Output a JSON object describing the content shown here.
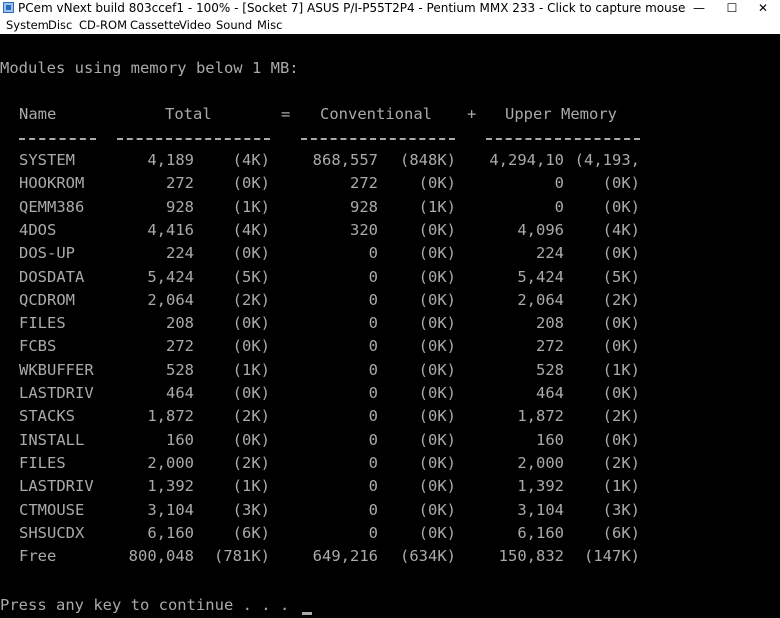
{
  "window": {
    "title": "PCem vNext build 803ccef1 - 100% - [Socket 7] ASUS P/I-P55T2P4 - Pentium MMX 233 - Click to capture mouse",
    "minimize_glyph": "—",
    "maximize_glyph": "☐",
    "close_glyph": "✕"
  },
  "menu": [
    "System",
    "Disc",
    "CD-ROM",
    "Cassette",
    "Video",
    "Sound",
    "Misc"
  ],
  "console": {
    "heading": "Modules using memory below 1 MB:",
    "columns": {
      "name": "Name",
      "total": "Total",
      "equals": "=",
      "conventional": "Conventional",
      "plus": "+",
      "upper": "Upper Memory"
    },
    "rows": [
      [
        "SYSTEM",
        "4,189",
        "(4K)",
        "868,557",
        "(848K)",
        "4,294,10",
        "(4,193,"
      ],
      [
        "HOOKROM",
        "272",
        "(0K)",
        "272",
        "(0K)",
        "0",
        "(0K)"
      ],
      [
        "QEMM386",
        "928",
        "(1K)",
        "928",
        "(1K)",
        "0",
        "(0K)"
      ],
      [
        "4DOS",
        "4,416",
        "(4K)",
        "320",
        "(0K)",
        "4,096",
        "(4K)"
      ],
      [
        "DOS-UP",
        "224",
        "(0K)",
        "0",
        "(0K)",
        "224",
        "(0K)"
      ],
      [
        "DOSDATA",
        "5,424",
        "(5K)",
        "0",
        "(0K)",
        "5,424",
        "(5K)"
      ],
      [
        "QCDROM",
        "2,064",
        "(2K)",
        "0",
        "(0K)",
        "2,064",
        "(2K)"
      ],
      [
        "FILES",
        "208",
        "(0K)",
        "0",
        "(0K)",
        "208",
        "(0K)"
      ],
      [
        "FCBS",
        "272",
        "(0K)",
        "0",
        "(0K)",
        "272",
        "(0K)"
      ],
      [
        "WKBUFFER",
        "528",
        "(1K)",
        "0",
        "(0K)",
        "528",
        "(1K)"
      ],
      [
        "LASTDRIV",
        "464",
        "(0K)",
        "0",
        "(0K)",
        "464",
        "(0K)"
      ],
      [
        "STACKS",
        "1,872",
        "(2K)",
        "0",
        "(0K)",
        "1,872",
        "(2K)"
      ],
      [
        "INSTALL",
        "160",
        "(0K)",
        "0",
        "(0K)",
        "160",
        "(0K)"
      ],
      [
        "FILES",
        "2,000",
        "(2K)",
        "0",
        "(0K)",
        "2,000",
        "(2K)"
      ],
      [
        "LASTDRIV",
        "1,392",
        "(1K)",
        "0",
        "(0K)",
        "1,392",
        "(1K)"
      ],
      [
        "CTMOUSE",
        "3,104",
        "(3K)",
        "0",
        "(0K)",
        "3,104",
        "(3K)"
      ],
      [
        "SHSUCDX",
        "6,160",
        "(6K)",
        "0",
        "(0K)",
        "6,160",
        "(6K)"
      ],
      [
        "Free",
        "800,048",
        "(781K)",
        "649,216",
        "(634K)",
        "150,832",
        "(147K)"
      ]
    ],
    "prompt": "Press any key to continue . . ."
  }
}
